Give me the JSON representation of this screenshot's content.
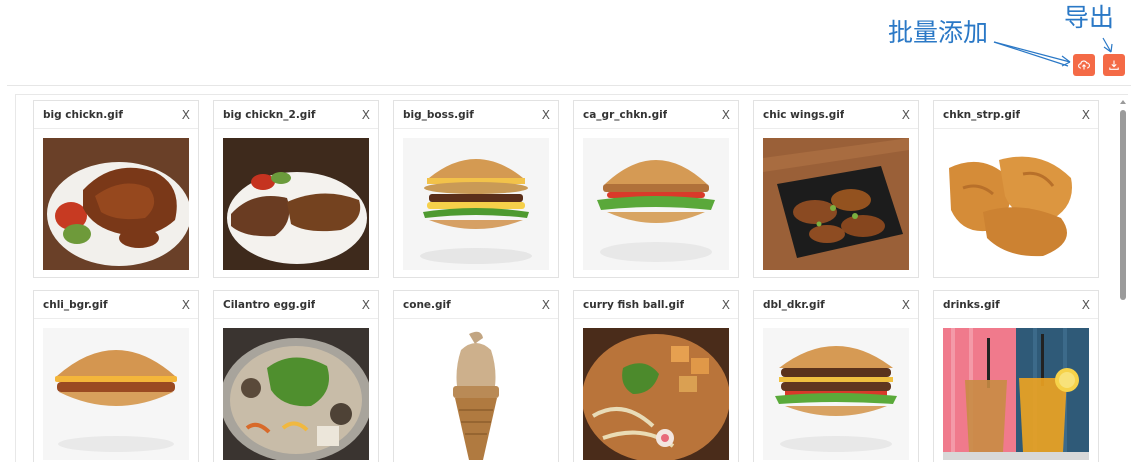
{
  "toolbar": {
    "batch_add_annotation": "批量添加",
    "export_annotation": "导出",
    "upload_icon": "cloud-upload-icon",
    "download_icon": "download-icon",
    "accent_color": "#f46a46",
    "annotation_color": "#2a78c6"
  },
  "cards": [
    {
      "title": "big chickn.gif",
      "close": "X",
      "image": "fried-chicken-plate"
    },
    {
      "title": "big chickn_2.gif",
      "close": "X",
      "image": "chicken-steak-plate"
    },
    {
      "title": "big_boss.gif",
      "close": "X",
      "image": "onion-ring-burger"
    },
    {
      "title": "ca_gr_chkn.gif",
      "close": "X",
      "image": "grilled-chicken-burger"
    },
    {
      "title": "chic wings.gif",
      "close": "X",
      "image": "chicken-wings-tray"
    },
    {
      "title": "chkn_strp.gif",
      "close": "X",
      "image": "chicken-strips"
    },
    {
      "title": "chli_bgr.gif",
      "close": "X",
      "image": "chili-burger"
    },
    {
      "title": "Cilantro egg.gif",
      "close": "X",
      "image": "cilantro-egg-hotpot"
    },
    {
      "title": "cone.gif",
      "close": "X",
      "image": "ice-cream-cone"
    },
    {
      "title": "curry fish ball.gif",
      "close": "X",
      "image": "curry-fish-ball-pot"
    },
    {
      "title": "dbl_dkr.gif",
      "close": "X",
      "image": "double-burger"
    },
    {
      "title": "drinks.gif",
      "close": "X",
      "image": "iced-drinks"
    }
  ]
}
